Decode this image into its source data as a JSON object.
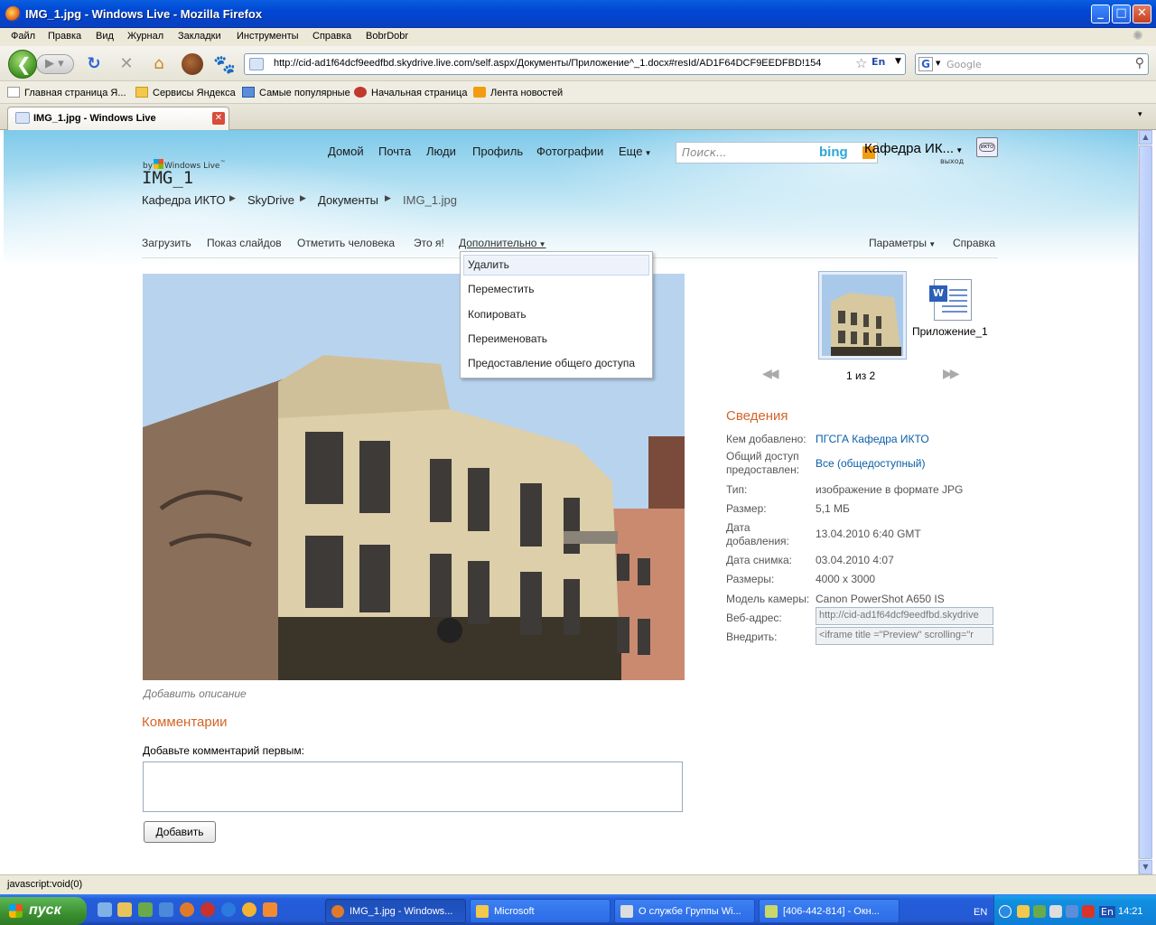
{
  "window": {
    "title": "IMG_1.jpg - Windows Live - Mozilla Firefox",
    "controls": {
      "minimize": "_",
      "maximize": "□",
      "close": "✕"
    }
  },
  "menubar": [
    "Файл",
    "Правка",
    "Вид",
    "Журнал",
    "Закладки",
    "Инструменты",
    "Справка",
    "BobrDobr"
  ],
  "toolbar": {
    "url": "http://cid-ad1f64dcf9eedfbd.skydrive.live.com/self.aspx/Документы/Приложение^_1.docx#resId/AD1F64DCF9EEDFBD!154",
    "lang": "En",
    "search_placeholder": "Google",
    "search_engine_letter": "G"
  },
  "bookmarks": [
    "Главная страница Я...",
    "Сервисы Яндекса",
    "Самые популярные",
    "Начальная страница",
    "Лента новостей"
  ],
  "tab": {
    "title": "IMG_1.jpg - Windows Live"
  },
  "page": {
    "by_prefix": "by",
    "logo_text": "Windows Live",
    "trademark": "™",
    "title": "IMG_1",
    "nav": [
      "Домой",
      "Почта",
      "Люди",
      "Профиль",
      "Фотографии",
      "Еще"
    ],
    "search_placeholder": "Поиск...",
    "search_brand": "bing",
    "user_name": "Кафедра ИК...",
    "user_exit": "выход",
    "avatar_text": "ИКТО",
    "breadcrumb": [
      "Кафедра ИКТО",
      "SkyDrive",
      "Документы",
      "IMG_1.jpg"
    ],
    "commands": [
      "Загрузить",
      "Показ слайдов",
      "Отметить человека",
      "Это я!",
      "Дополнительно"
    ],
    "commands_right": [
      "Параметры",
      "Справка"
    ],
    "dropdown": [
      "Удалить",
      "Переместить",
      "Копировать",
      "Переименовать",
      "Предоставление общего доступа"
    ],
    "add_description": "Добавить описание",
    "comments_header": "Комментарии",
    "comments_label": "Добавьте комментарий первым:",
    "add_button": "Добавить",
    "thumb_doc_label": "Приложение_1",
    "doc_icon_letter": "W",
    "page_counter": "1 из 2",
    "info_header": "Сведения",
    "info": [
      {
        "label": "Кем добавлено:",
        "value": "ПГСГА Кафедра ИКТО"
      },
      {
        "label": "Общий доступ предоставлен:",
        "value": "Все (общедоступный)"
      },
      {
        "label": "Тип:",
        "value": "изображение в формате JPG"
      },
      {
        "label": "Размер:",
        "value": "5,1 МБ"
      },
      {
        "label": "Дата добавления:",
        "value": "13.04.2010 6:40 GMT"
      },
      {
        "label": "Дата снимка:",
        "value": "03.04.2010 4:07"
      },
      {
        "label": "Размеры:",
        "value": "4000 x 3000"
      },
      {
        "label": "Модель камеры:",
        "value": "Canon PowerShot A650 IS"
      },
      {
        "label": "Веб-адрес:",
        "value": "http://cid-ad1f64dcf9eedfbd.skydrive"
      },
      {
        "label": "Внедрить:",
        "value": "<iframe title =\"Preview\" scrolling=\"r"
      }
    ]
  },
  "statusbar": "javascript:void(0)",
  "taskbar": {
    "start": "пуск",
    "tasks": [
      "IMG_1.jpg - Windows...",
      "Microsoft",
      "О службе Группы Wi...",
      "[406-442-814] - Окн..."
    ],
    "lang": "EN",
    "tray_lang": "En",
    "clock": "14:21"
  },
  "colors": {
    "accent_orange": "#d4642a",
    "link_blue": "#0b5ea8",
    "xp_blue": "#245edb",
    "start_green": "#3b8f30"
  }
}
